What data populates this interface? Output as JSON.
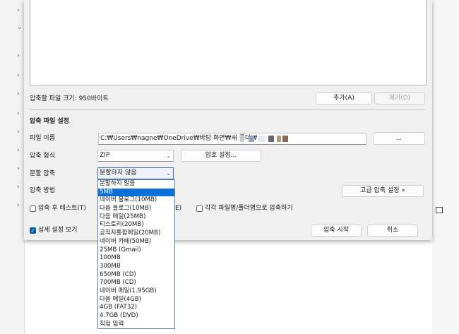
{
  "dialog": {
    "size_label": "압축할 파일 크기: 950바이트",
    "add_button": "추가(A)",
    "remove_button": "제거(D)",
    "section_title": "압축 파일 설정",
    "file_name_label": "파일 이름",
    "file_path_value": "C:₩Users₩nagne₩OneDrive₩바탕 화면₩새 폴더₩",
    "browse_button": "...",
    "format_label": "압축 형식",
    "format_value": "ZIP",
    "password_button": "암호 설정...",
    "split_label": "분할 압축",
    "split_value": "분할하지 않음",
    "method_label": "압축 방법",
    "advanced_button": "고급 압축 설정 »",
    "test_after_label": "압축 후 테스트(T)",
    "hidden_option_suffix": "E)",
    "each_folder_label": "각각 파일명/폴더명으로 압축하기",
    "show_details_label": "상세 설정 보기",
    "start_button": "압축 시작",
    "cancel_button": "취소"
  },
  "split_dropdown": {
    "options": [
      "분할하지 않음",
      "5MB",
      "네이버 블로그(10MB)",
      "다음 블로그(10MB)",
      "다음 메일(25MB)",
      "티스토리(20MB)",
      "공직자통합메일(20MB)",
      "네이버 카페(50MB)",
      "25MB (Gmail)",
      "100MB",
      "300MB",
      "650MB (CD)",
      "700MB (CD)",
      "네이버 메일(1.95GB)",
      "다음 메일(4GB)",
      "4GB (FAT32)",
      "4.7GB (DVD)",
      "직접 입력"
    ],
    "highlighted_index": 1
  },
  "colors": {
    "accent": "#0a6fd6",
    "dialog_bg": "#f0f0f0",
    "checkbox_on": "#0b5cad"
  }
}
